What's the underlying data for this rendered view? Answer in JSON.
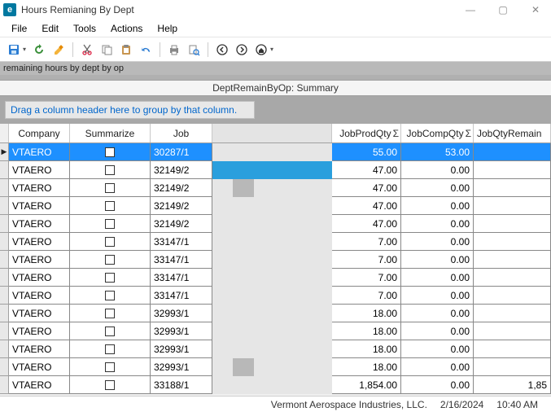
{
  "window": {
    "title": "Hours Remianing By Dept"
  },
  "menu": {
    "file": "File",
    "edit": "Edit",
    "tools": "Tools",
    "actions": "Actions",
    "help": "Help"
  },
  "breadcrumb": "remaining hours by dept by op",
  "summary_header": "DeptRemainByOp: Summary",
  "group_hint": "Drag a column header here to group by that column.",
  "columns": {
    "company": "Company",
    "summarize": "Summarize",
    "job": "Job",
    "jobprodqty": "JobProdQty",
    "jobcompqty": "JobCompQty",
    "jobqtyremain": "JobQtyRemain"
  },
  "rows": [
    {
      "company": "VTAERO",
      "job": "30287/1",
      "prod": "55.00",
      "comp": "53.00",
      "rem": "",
      "sel": true,
      "scrubgap": false
    },
    {
      "company": "VTAERO",
      "job": "32149/2",
      "prod": "47.00",
      "comp": "0.00",
      "rem": "",
      "sel": false,
      "hover": true,
      "scrubgap": false
    },
    {
      "company": "VTAERO",
      "job": "32149/2",
      "prod": "47.00",
      "comp": "0.00",
      "rem": "",
      "scrubgap": true
    },
    {
      "company": "VTAERO",
      "job": "32149/2",
      "prod": "47.00",
      "comp": "0.00",
      "rem": ""
    },
    {
      "company": "VTAERO",
      "job": "32149/2",
      "prod": "47.00",
      "comp": "0.00",
      "rem": ""
    },
    {
      "company": "VTAERO",
      "job": "33147/1",
      "prod": "7.00",
      "comp": "0.00",
      "rem": ""
    },
    {
      "company": "VTAERO",
      "job": "33147/1",
      "prod": "7.00",
      "comp": "0.00",
      "rem": ""
    },
    {
      "company": "VTAERO",
      "job": "33147/1",
      "prod": "7.00",
      "comp": "0.00",
      "rem": ""
    },
    {
      "company": "VTAERO",
      "job": "33147/1",
      "prod": "7.00",
      "comp": "0.00",
      "rem": ""
    },
    {
      "company": "VTAERO",
      "job": "32993/1",
      "prod": "18.00",
      "comp": "0.00",
      "rem": ""
    },
    {
      "company": "VTAERO",
      "job": "32993/1",
      "prod": "18.00",
      "comp": "0.00",
      "rem": ""
    },
    {
      "company": "VTAERO",
      "job": "32993/1",
      "prod": "18.00",
      "comp": "0.00",
      "rem": ""
    },
    {
      "company": "VTAERO",
      "job": "32993/1",
      "prod": "18.00",
      "comp": "0.00",
      "rem": "",
      "scrubgap": true
    },
    {
      "company": "VTAERO",
      "job": "33188/1",
      "prod": "1,854.00",
      "comp": "0.00",
      "rem": "1,85"
    }
  ],
  "status": {
    "company": "Vermont Aerospace Industries, LLC.",
    "date": "2/16/2024",
    "time": "10:40 AM"
  }
}
